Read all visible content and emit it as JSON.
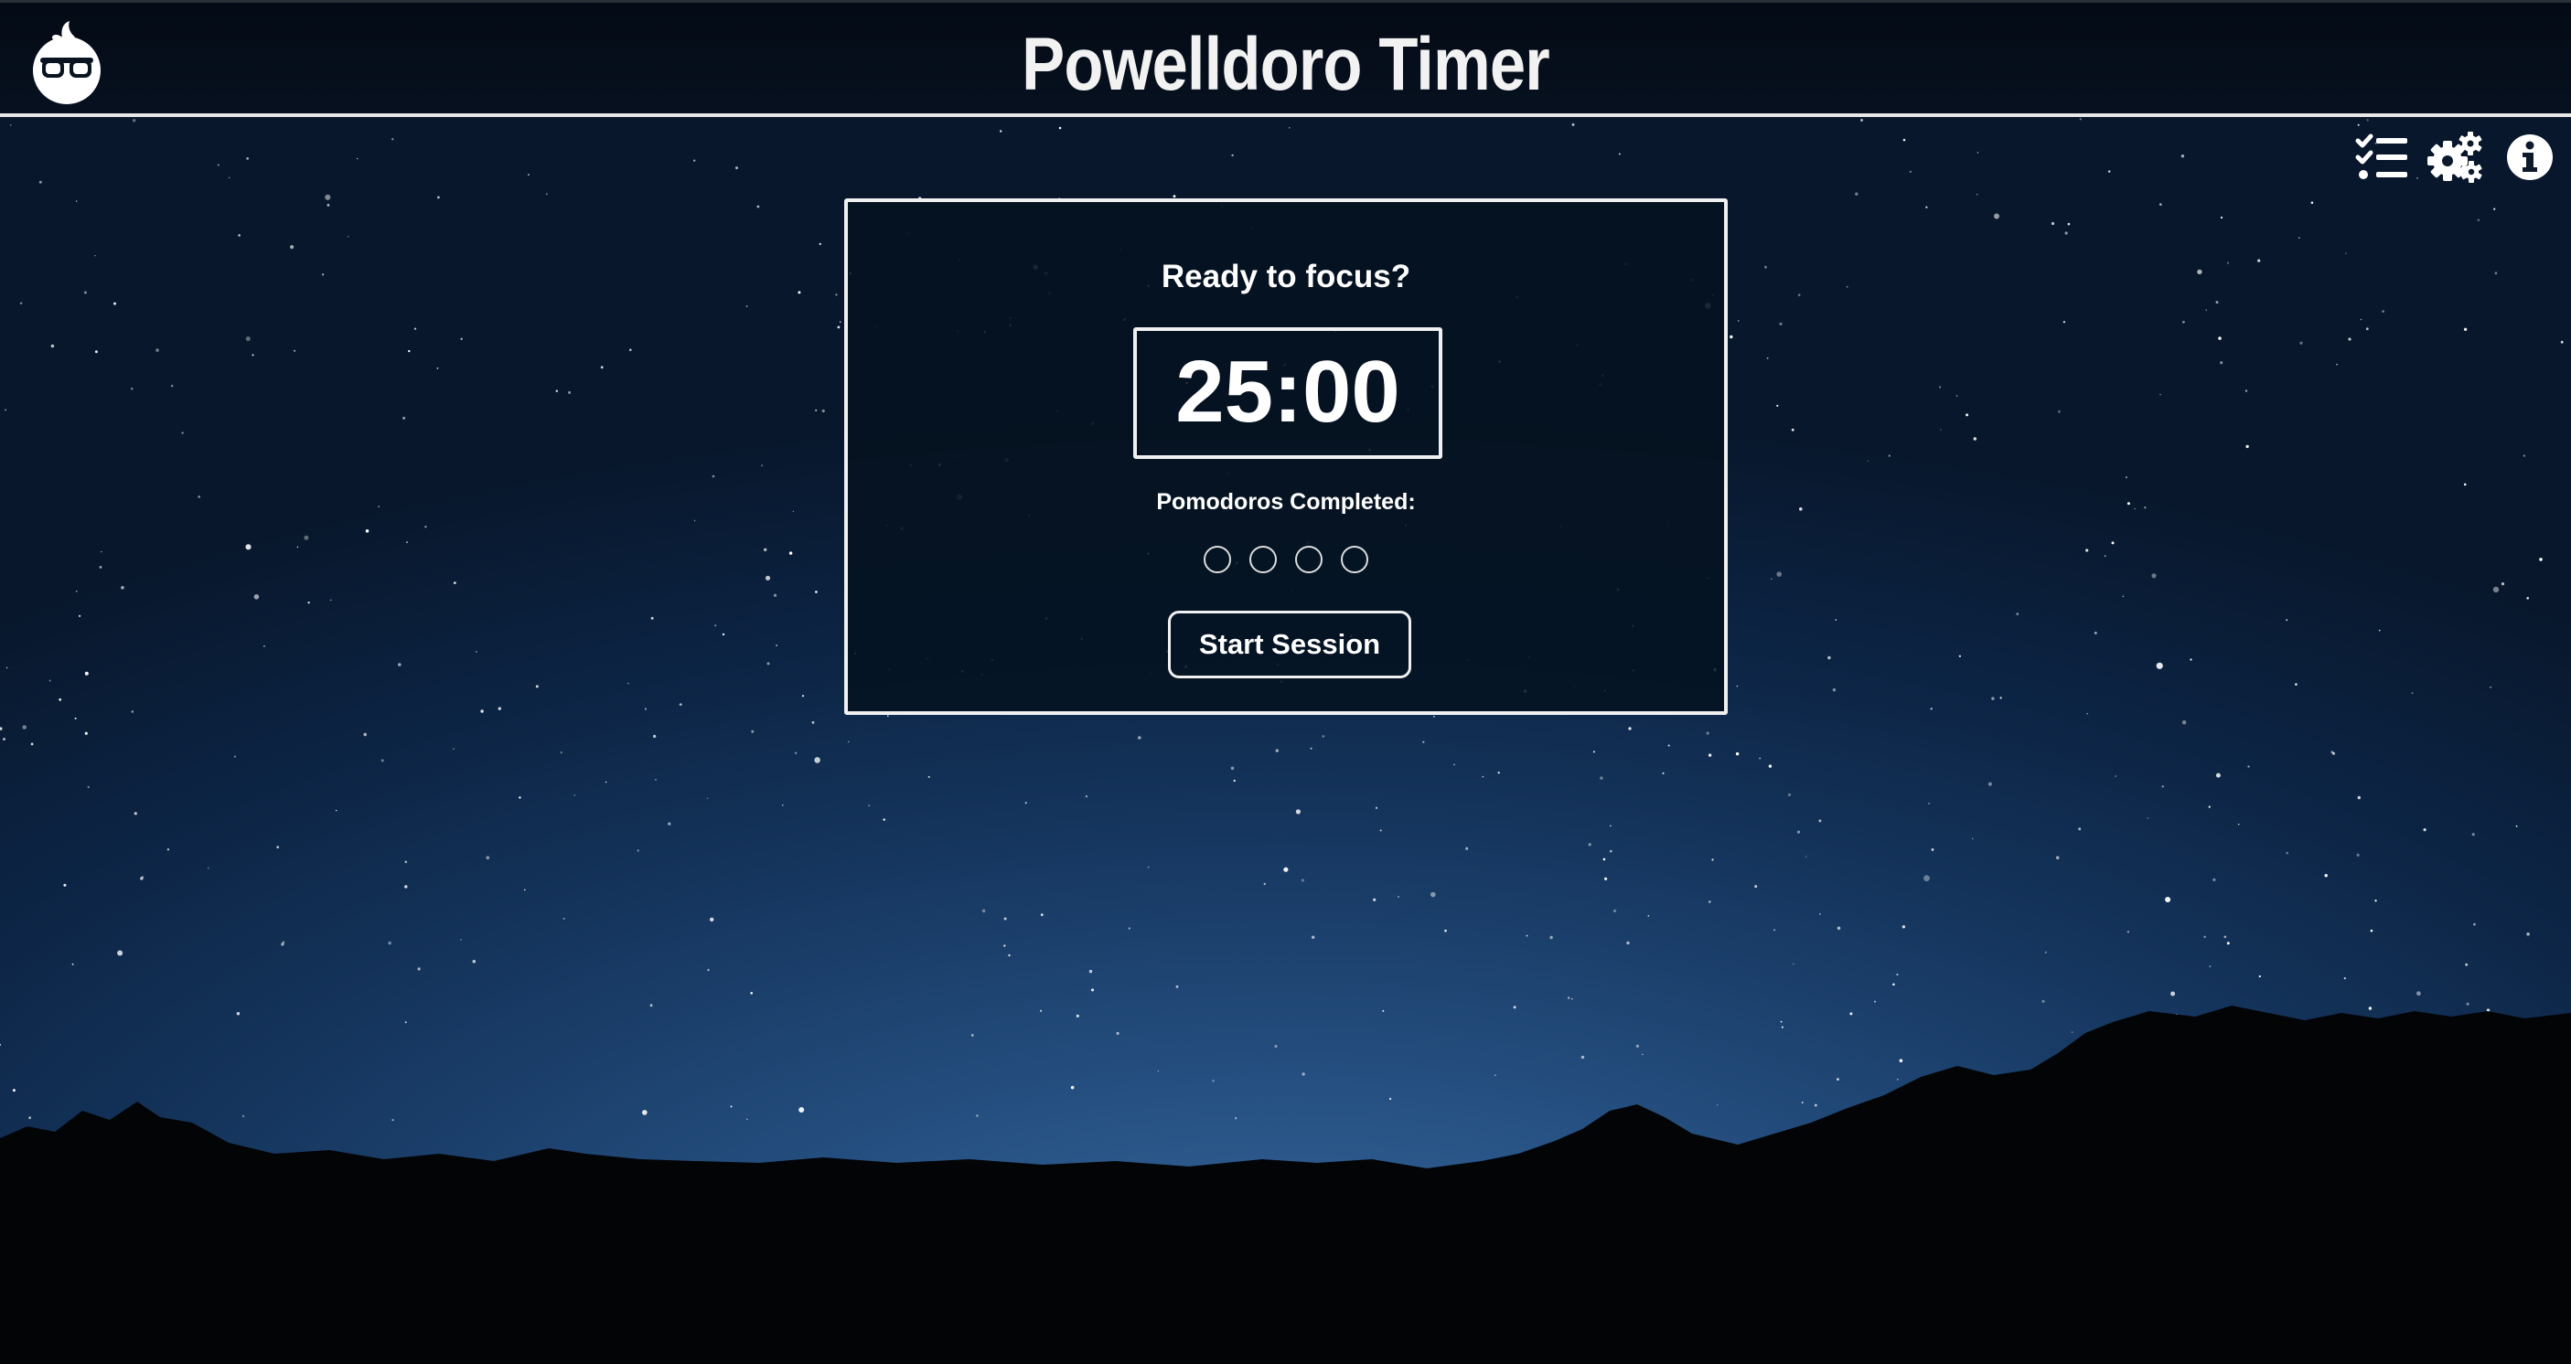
{
  "header": {
    "title": "Powelldoro Timer",
    "logo_icon": "nerd-tomato-logo-icon"
  },
  "toolbar": {
    "icons": [
      "task-list-icon",
      "settings-gears-icon",
      "info-icon"
    ]
  },
  "timer": {
    "prompt": "Ready to focus?",
    "time": "25:00",
    "completed_label": "Pomodoros Completed:",
    "pomodoros_completed": 0,
    "pomodoros_total": 4,
    "start_button_label": "Start Session"
  },
  "colors": {
    "border": "#f0f0f0",
    "text": "#ffffff",
    "card_background": "#041220",
    "sky_top": "#08172c",
    "sky_bottom": "#3a6ba3"
  }
}
